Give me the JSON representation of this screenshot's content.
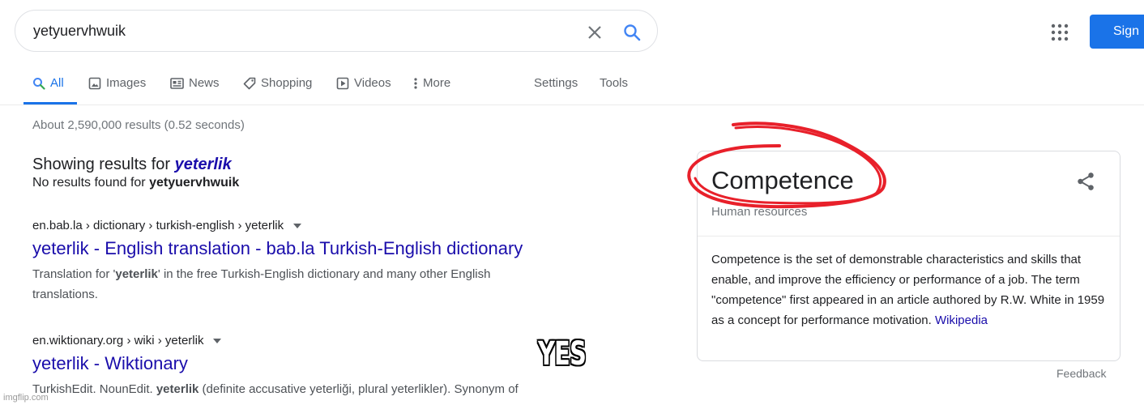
{
  "search": {
    "query": "yetyuervhwuik"
  },
  "header": {
    "signin_label": "Sign"
  },
  "tabs": [
    {
      "label": "All",
      "icon": "search-icon"
    },
    {
      "label": "Images",
      "icon": "image-icon"
    },
    {
      "label": "News",
      "icon": "news-icon"
    },
    {
      "label": "Shopping",
      "icon": "tag-icon"
    },
    {
      "label": "Videos",
      "icon": "play-icon"
    },
    {
      "label": "More",
      "icon": "more-vertical-icon"
    }
  ],
  "tools": {
    "settings": "Settings",
    "tools": "Tools"
  },
  "stats": "About 2,590,000 results (0.52 seconds)",
  "spelling": {
    "showing_prefix": "Showing results for ",
    "corrected": "yeterlik",
    "no_results_prefix": "No results found for ",
    "original": "yetyuervhwuik"
  },
  "results": [
    {
      "url": "en.bab.la › dictionary › turkish-english › yeterlik",
      "title": "yeterlik - English translation - bab.la Turkish-English dictionary",
      "snippet_pre": "Translation for '",
      "snippet_bold": "yeterlik",
      "snippet_post": "' in the free Turkish-English dictionary and many other English translations."
    },
    {
      "url": "en.wiktionary.org › wiki › yeterlik",
      "title": "yeterlik - Wiktionary",
      "snippet_pre": "TurkishEdit. NounEdit. ",
      "snippet_bold": "yeterlik",
      "snippet_post": " (definite accusative yeterliği, plural yeterlikler). Synonym of"
    }
  ],
  "knowledge_panel": {
    "title": "Competence",
    "subtitle": "Human resources",
    "description": "Competence is the set of demonstrable characteristics and skills that enable, and improve the efficiency or performance of a job. The term \"competence\" first appeared in an article authored by R.W. White in 1959 as a concept for performance motivation. ",
    "source_link": "Wikipedia"
  },
  "feedback": "Feedback",
  "meme_caption": "YES",
  "watermark": "imgflip.com",
  "colors": {
    "link": "#1a0dab",
    "accent": "#1a73e8",
    "scribble": "#e8202a"
  }
}
